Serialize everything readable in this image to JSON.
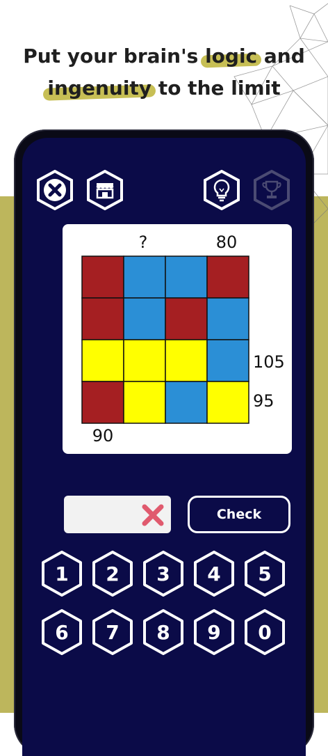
{
  "headline": {
    "line1_pre": "Put your brain's ",
    "line1_highlight": "logic",
    "line1_post": " and",
    "line2_highlight": "ingenuity",
    "line2_post": " to the limit"
  },
  "toolbar": {
    "close_icon": "close-x-icon",
    "shop_icon": "shop-store-icon",
    "hint_icon": "lightbulb-icon",
    "trophy_icon": "trophy-icon"
  },
  "puzzle": {
    "top_labels": [
      "?",
      "80"
    ],
    "right_labels": [
      "105",
      "95"
    ],
    "bottom_label": "90",
    "colors": {
      "R": "#a51f22",
      "B": "#2b8fd6",
      "Y": "#ffff00"
    },
    "grid": [
      [
        "R",
        "B",
        "B",
        "R"
      ],
      [
        "R",
        "B",
        "R",
        "B"
      ],
      [
        "Y",
        "Y",
        "Y",
        "B"
      ],
      [
        "R",
        "Y",
        "B",
        "Y"
      ]
    ]
  },
  "answer": {
    "value": "",
    "clear_icon": "clear-x-icon"
  },
  "check_label": "Check",
  "keypad": {
    "row1": [
      "1",
      "2",
      "3",
      "4",
      "5"
    ],
    "row2": [
      "6",
      "7",
      "8",
      "9",
      "0"
    ]
  },
  "colors": {
    "screen": "#0b0b48",
    "band": "#bdb65c",
    "highlight": "#c7bf55",
    "clear_x": "#e05a6e"
  }
}
